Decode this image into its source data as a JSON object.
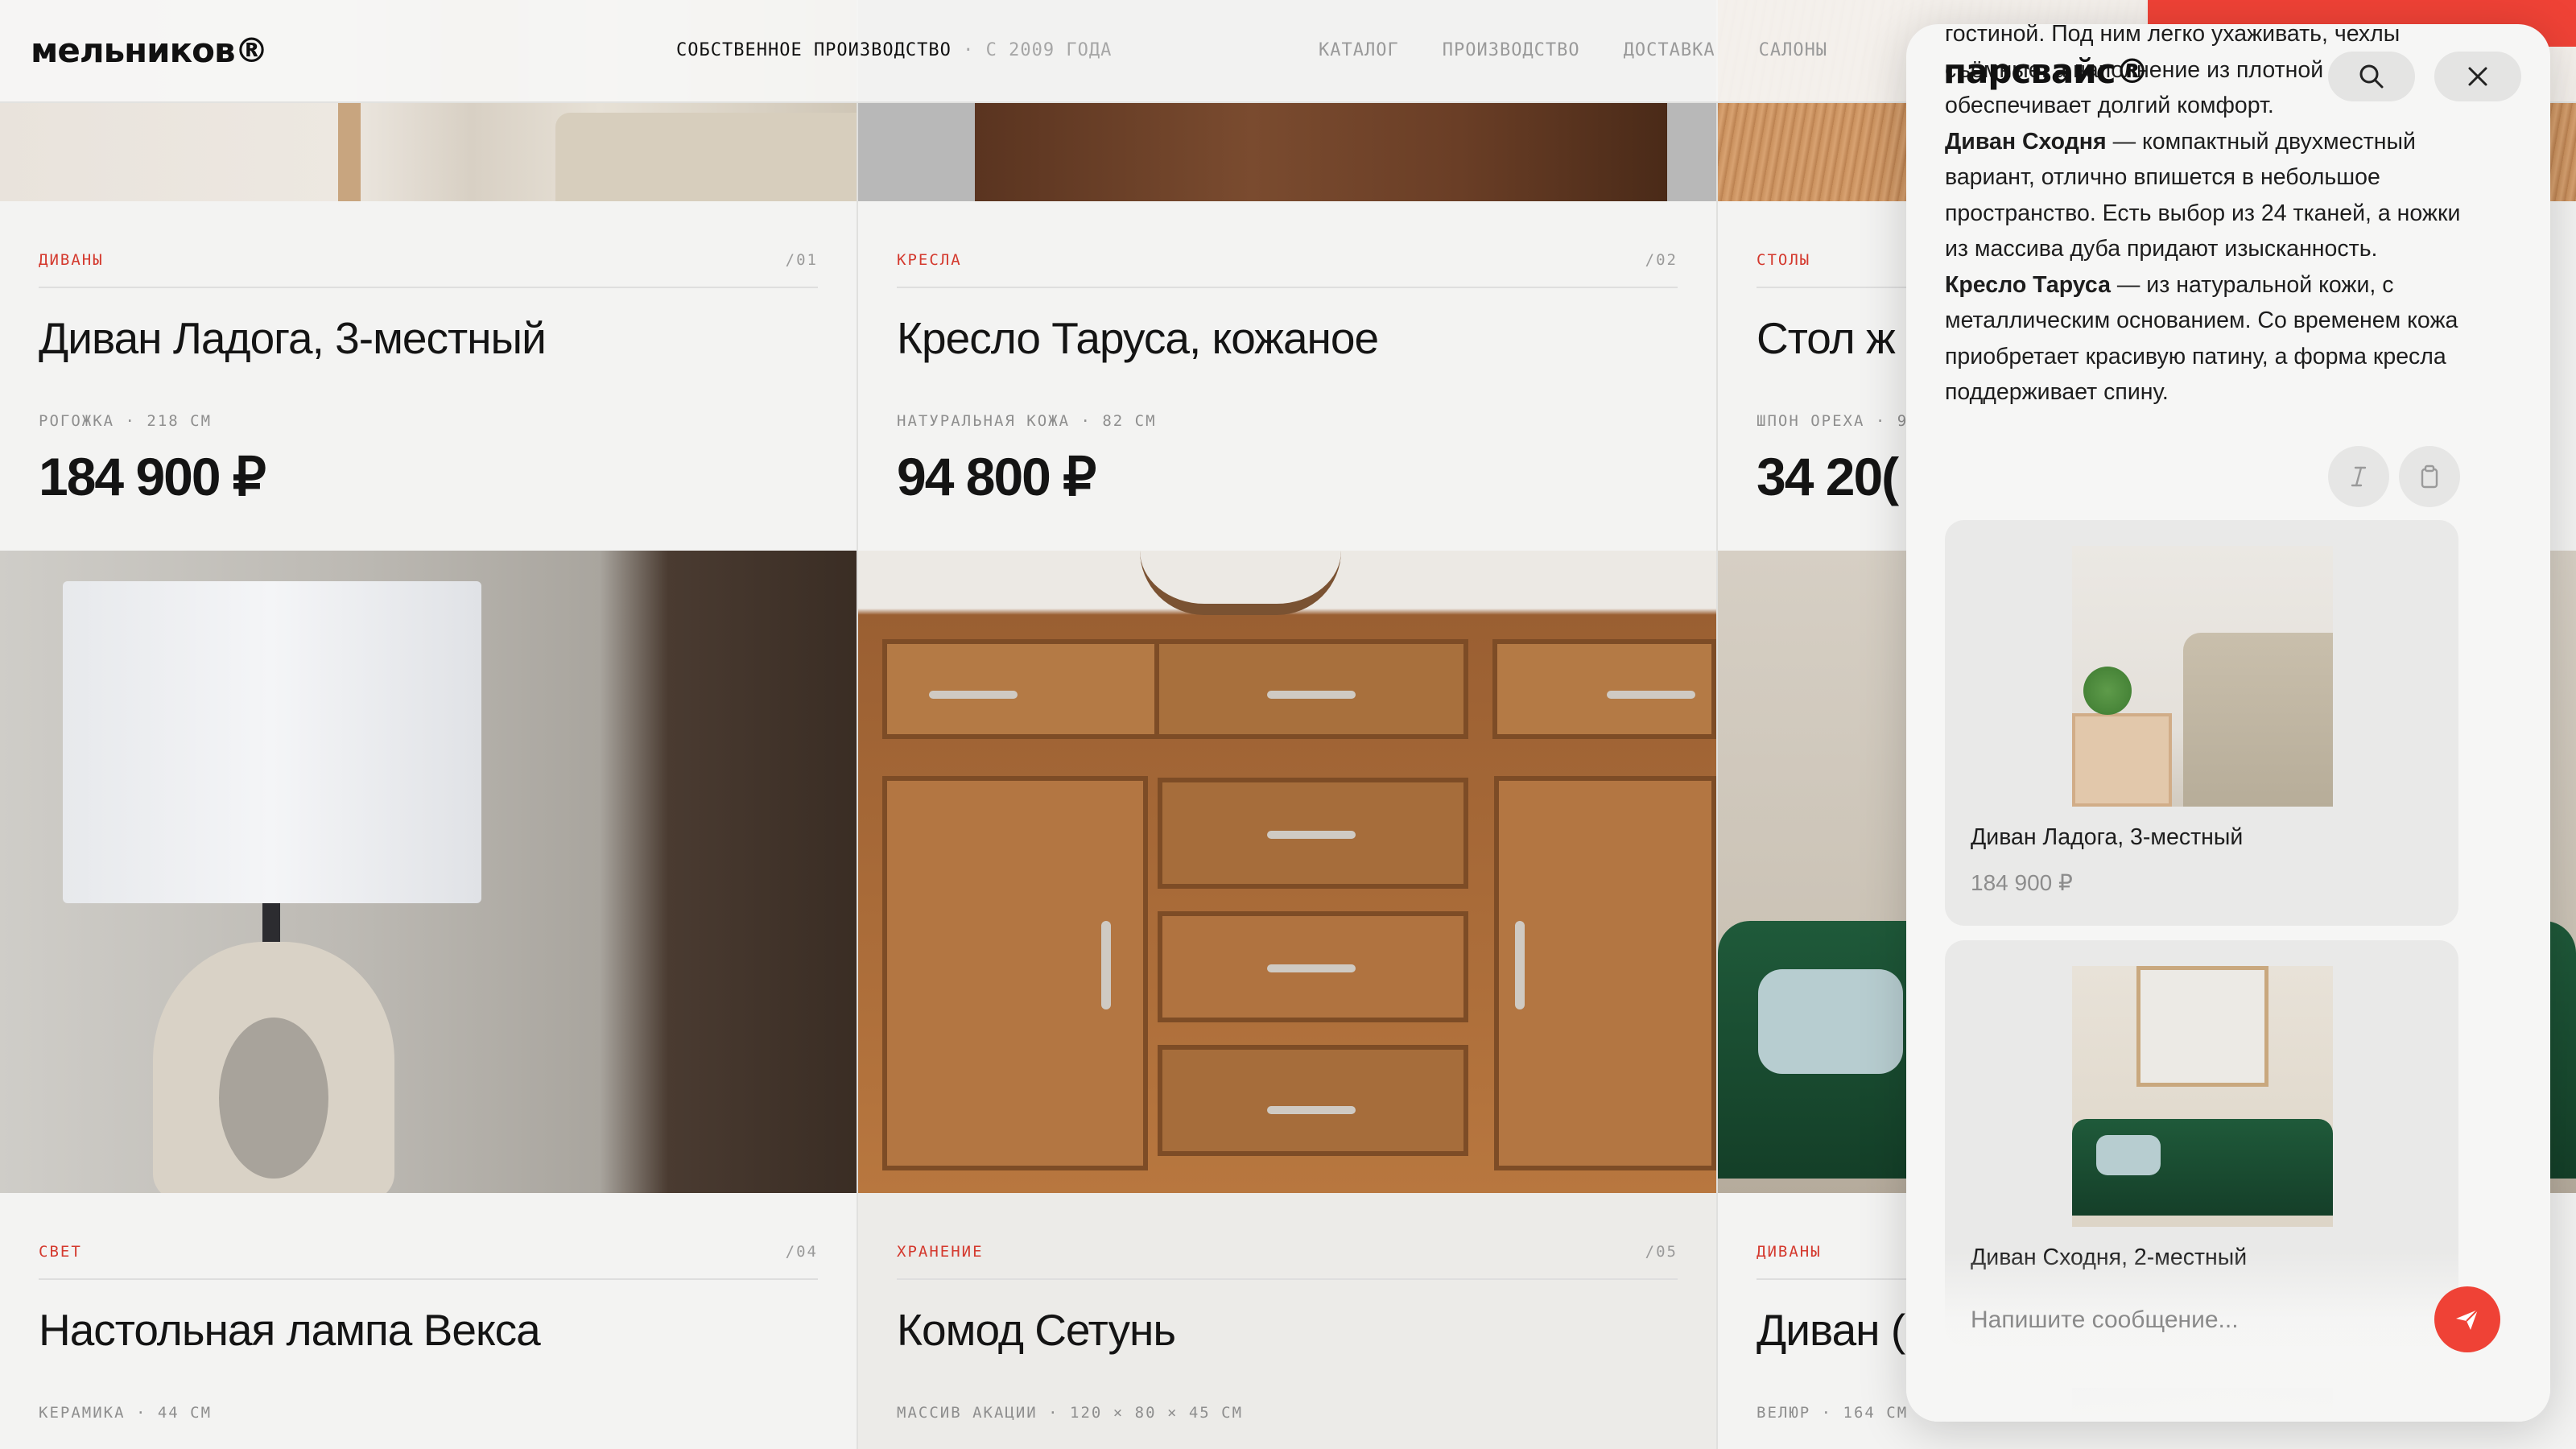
{
  "brand": {
    "logo": "мельников®"
  },
  "header": {
    "tagline_main": "СОБСТВЕННОЕ ПРОИЗВОДСТВО",
    "tagline_sub": "· С 2009 ГОДА",
    "nav": [
      "КАТАЛОГ",
      "ПРОИЗВОДСТВО",
      "ДОСТАВКА",
      "САЛОНЫ"
    ]
  },
  "products": [
    {
      "category": "ДИВАНЫ",
      "num": "/01",
      "title": "Диван Ладога, 3-местный",
      "meta": "РОГОЖКА · 218 СМ",
      "price": "184 900 ₽"
    },
    {
      "category": "КРЕСЛА",
      "num": "/02",
      "title": "Кресло Таруса, кожаное",
      "meta": "НАТУРАЛЬНАЯ КОЖА · 82 СМ",
      "price": "94 800 ₽"
    },
    {
      "category": "СТОЛЫ",
      "num": "",
      "title": "Стол ж",
      "meta": "ШПОН ОРЕХА · 9",
      "price": "34 20("
    },
    {
      "category": "СВЕТ",
      "num": "/04",
      "title": "Настольная лампа Векса",
      "meta": "КЕРАМИКА · 44 СМ",
      "price": ""
    },
    {
      "category": "ХРАНЕНИЕ",
      "num": "/05",
      "title": "Комод Сетунь",
      "meta": "МАССИВ АКАЦИИ · 120 × 80 × 45 СМ",
      "price": ""
    },
    {
      "category": "ДИВАНЫ",
      "num": "",
      "title": "Диван (",
      "meta": "ВЕЛЮР · 164 СМ",
      "price": ""
    }
  ],
  "chat": {
    "brand": "парсвайс®",
    "search_icon": "search-icon",
    "close_icon": "close-icon",
    "message": {
      "line_top": "гостиной. Под ним легко ухаживать, чехлы",
      "line_2": "съёмные, а наполнение из плотной",
      "line_3": "обеспечивает долгий комфорт.",
      "p2_bold": "Диван Сходня",
      "p2_text": " — компактный двухместный вариант, отлично впишется в небольшое пространство. Есть выбор из 24 тканей, а ножки из массива дуба придают изысканность.",
      "p3_bold": "Кресло Таруса",
      "p3_text": " — из натуральной кожи, с металлическим основанием. Со временем кожа приобретает красивую патину, а форма кресла поддерживает спину."
    },
    "tools": [
      "italic-icon",
      "clipboard-icon"
    ],
    "cards": [
      {
        "name": "Диван Ладога, 3-местный",
        "price": "184 900 ₽"
      },
      {
        "name": "Диван Сходня, 2-местный",
        "price": ""
      }
    ],
    "input_placeholder": "Напишите сообщение...",
    "send_icon": "send-icon"
  }
}
